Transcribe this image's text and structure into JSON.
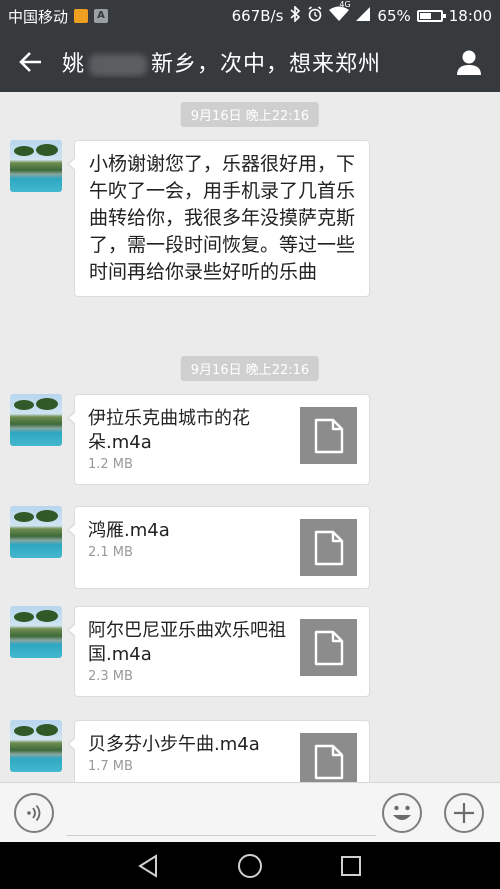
{
  "status_bar": {
    "carrier": "中国移动",
    "speed": "667B/s",
    "network": "4G",
    "battery": "65%",
    "battery_fraction": 0.65,
    "time": "18:00",
    "icons": [
      "notification-icon",
      "a-badge-icon",
      "bluetooth-icon",
      "alarm-icon",
      "wifi-icon",
      "signal-icon",
      "battery-icon"
    ]
  },
  "title_bar": {
    "title_prefix": "姚",
    "title_suffix": "新乡，次中，想来郑州"
  },
  "messages": [
    {
      "type": "timestamp",
      "text": "9月16日 晚上22:16"
    },
    {
      "type": "text",
      "text": "小杨谢谢您了，乐器很好用，下午吹了一会，用手机录了几首乐曲转给你，我很多年没摸萨克斯了，需一段时间恢复。等过一些时间再给你录些好听的乐曲"
    },
    {
      "type": "timestamp",
      "text": "9月16日 晚上22:16"
    },
    {
      "type": "file",
      "name": "伊拉乐克曲城市的花朵.m4a",
      "size": "1.2 MB"
    },
    {
      "type": "file",
      "name": "鸿雁.m4a",
      "size": "2.1 MB"
    },
    {
      "type": "file",
      "name": "阿尔巴尼亚乐曲欢乐吧祖国.m4a",
      "size": "2.3 MB"
    },
    {
      "type": "file",
      "name": "贝多芬小步午曲.m4a",
      "size": "1.7 MB"
    }
  ],
  "input_bar": {
    "placeholder": ""
  },
  "colors": {
    "header_bg": "#363a3d",
    "chat_bg": "#ebebeb",
    "bubble_bg": "#ffffff",
    "timestamp_bg": "#cfcfcf",
    "file_icon_bg": "#8c8c8c"
  }
}
